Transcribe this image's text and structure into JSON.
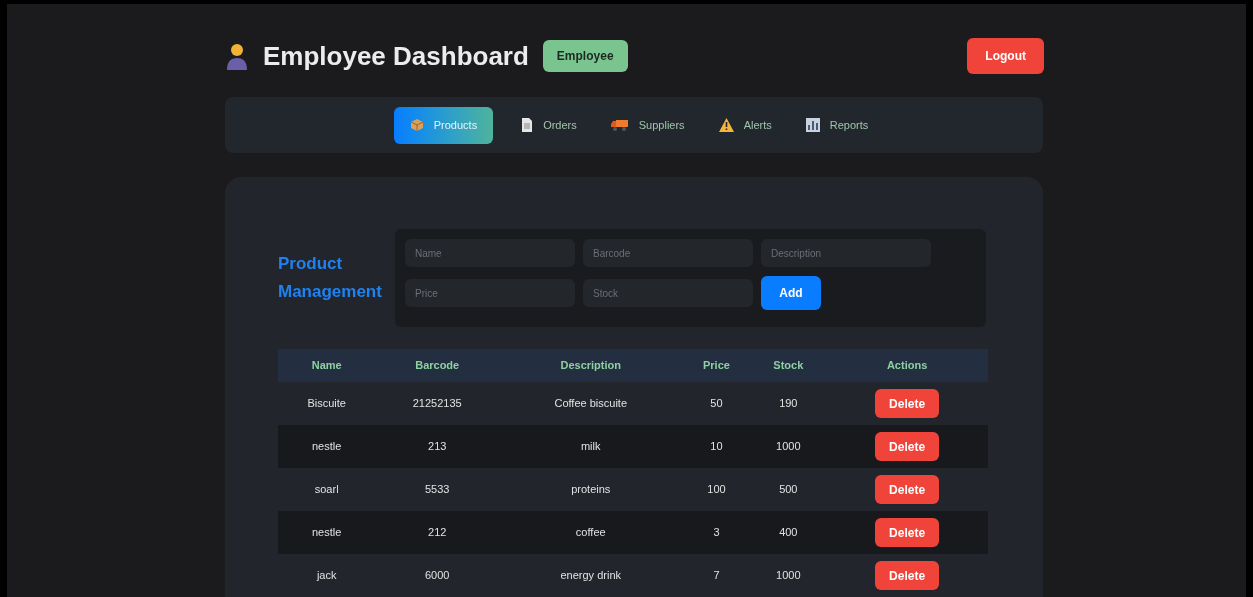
{
  "header": {
    "title": "Employee Dashboard",
    "role_badge": "Employee",
    "logout": "Logout"
  },
  "tabs": [
    {
      "label": "Products",
      "kind": "box",
      "selected": true
    },
    {
      "label": "Orders",
      "kind": "page",
      "selected": false
    },
    {
      "label": "Suppliers",
      "kind": "truck",
      "selected": false
    },
    {
      "label": "Alerts",
      "kind": "warning",
      "selected": false
    },
    {
      "label": "Reports",
      "kind": "chart",
      "selected": false
    }
  ],
  "form": {
    "title": "Product Management",
    "fields": [
      {
        "placeholder": "Name"
      },
      {
        "placeholder": "Barcode"
      },
      {
        "placeholder": "Description"
      },
      {
        "placeholder": "Price"
      },
      {
        "placeholder": "Stock"
      }
    ],
    "submit": "Add"
  },
  "table": {
    "columns": [
      "Name",
      "Barcode",
      "Description",
      "Price",
      "Stock",
      "Actions"
    ],
    "rows": [
      {
        "cells": [
          "Biscuite",
          "21252135",
          "Coffee biscuite",
          "50",
          "190"
        ],
        "action": "Delete"
      },
      {
        "cells": [
          "nestle",
          "213",
          "milk",
          "10",
          "1000"
        ],
        "action": "Delete"
      },
      {
        "cells": [
          "soarl",
          "5533",
          "proteins",
          "100",
          "500"
        ],
        "action": "Delete"
      },
      {
        "cells": [
          "nestle",
          "212",
          "coffee",
          "3",
          "400"
        ],
        "action": "Delete"
      },
      {
        "cells": [
          "jack",
          "6000",
          "energy drink",
          "7",
          "1000"
        ],
        "action": "Delete"
      }
    ]
  }
}
